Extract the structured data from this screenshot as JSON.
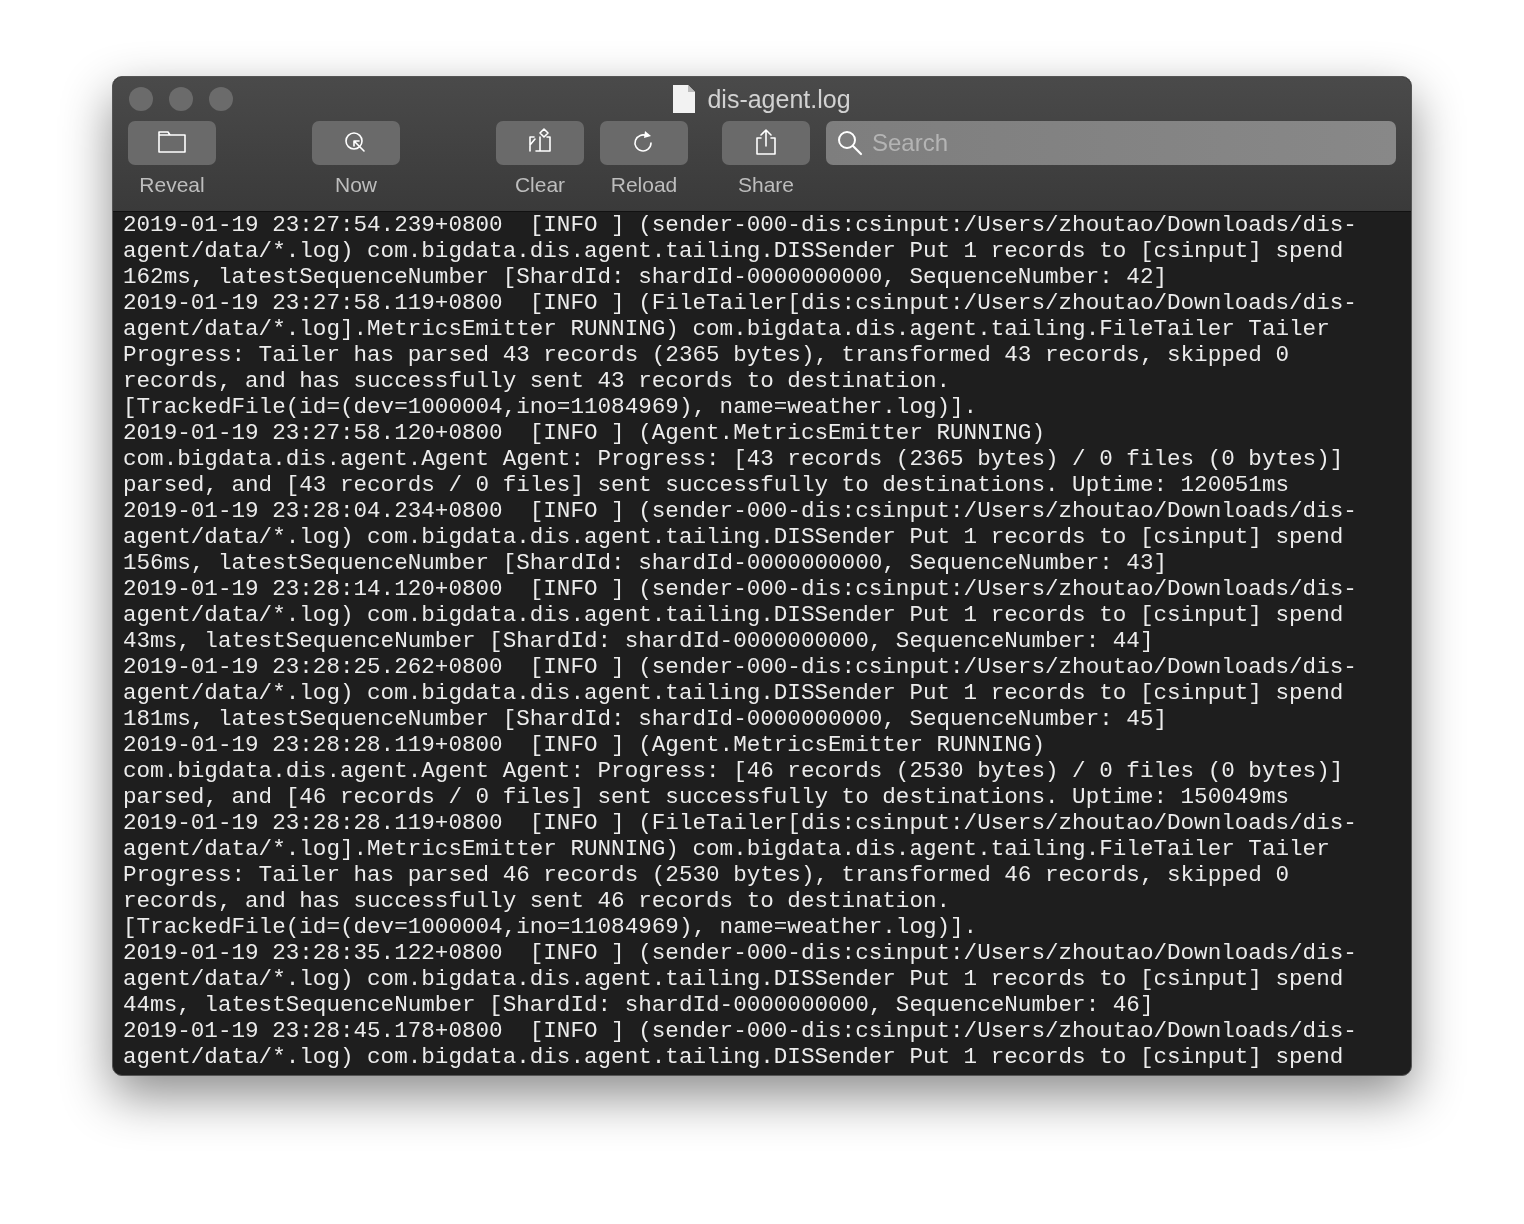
{
  "window": {
    "title": "dis-agent.log"
  },
  "toolbar": {
    "items": [
      {
        "label": "Reveal"
      },
      {
        "label": "Now"
      },
      {
        "label": "Clear"
      },
      {
        "label": "Reload"
      },
      {
        "label": "Share"
      }
    ]
  },
  "search": {
    "placeholder": "Search"
  },
  "log": {
    "lines": [
      "2019-01-19 23:27:54.239+0800  [INFO ] (sender-000-dis:csinput:/Users/zhoutao/Downloads/dis-",
      "agent/data/*.log) com.bigdata.dis.agent.tailing.DISSender Put 1 records to [csinput] spend",
      "162ms, latestSequenceNumber [ShardId: shardId-0000000000, SequenceNumber: 42]",
      "2019-01-19 23:27:58.119+0800  [INFO ] (FileTailer[dis:csinput:/Users/zhoutao/Downloads/dis-",
      "agent/data/*.log].MetricsEmitter RUNNING) com.bigdata.dis.agent.tailing.FileTailer Tailer",
      "Progress: Tailer has parsed 43 records (2365 bytes), transformed 43 records, skipped 0",
      "records, and has successfully sent 43 records to destination.",
      "[TrackedFile(id=(dev=1000004,ino=11084969), name=weather.log)].",
      "2019-01-19 23:27:58.120+0800  [INFO ] (Agent.MetricsEmitter RUNNING)",
      "com.bigdata.dis.agent.Agent Agent: Progress: [43 records (2365 bytes) / 0 files (0 bytes)]",
      "parsed, and [43 records / 0 files] sent successfully to destinations. Uptime: 120051ms",
      "2019-01-19 23:28:04.234+0800  [INFO ] (sender-000-dis:csinput:/Users/zhoutao/Downloads/dis-",
      "agent/data/*.log) com.bigdata.dis.agent.tailing.DISSender Put 1 records to [csinput] spend",
      "156ms, latestSequenceNumber [ShardId: shardId-0000000000, SequenceNumber: 43]",
      "2019-01-19 23:28:14.120+0800  [INFO ] (sender-000-dis:csinput:/Users/zhoutao/Downloads/dis-",
      "agent/data/*.log) com.bigdata.dis.agent.tailing.DISSender Put 1 records to [csinput] spend",
      "43ms, latestSequenceNumber [ShardId: shardId-0000000000, SequenceNumber: 44]",
      "2019-01-19 23:28:25.262+0800  [INFO ] (sender-000-dis:csinput:/Users/zhoutao/Downloads/dis-",
      "agent/data/*.log) com.bigdata.dis.agent.tailing.DISSender Put 1 records to [csinput] spend",
      "181ms, latestSequenceNumber [ShardId: shardId-0000000000, SequenceNumber: 45]",
      "2019-01-19 23:28:28.119+0800  [INFO ] (Agent.MetricsEmitter RUNNING)",
      "com.bigdata.dis.agent.Agent Agent: Progress: [46 records (2530 bytes) / 0 files (0 bytes)]",
      "parsed, and [46 records / 0 files] sent successfully to destinations. Uptime: 150049ms",
      "2019-01-19 23:28:28.119+0800  [INFO ] (FileTailer[dis:csinput:/Users/zhoutao/Downloads/dis-",
      "agent/data/*.log].MetricsEmitter RUNNING) com.bigdata.dis.agent.tailing.FileTailer Tailer",
      "Progress: Tailer has parsed 46 records (2530 bytes), transformed 46 records, skipped 0",
      "records, and has successfully sent 46 records to destination.",
      "[TrackedFile(id=(dev=1000004,ino=11084969), name=weather.log)].",
      "2019-01-19 23:28:35.122+0800  [INFO ] (sender-000-dis:csinput:/Users/zhoutao/Downloads/dis-",
      "agent/data/*.log) com.bigdata.dis.agent.tailing.DISSender Put 1 records to [csinput] spend",
      "44ms, latestSequenceNumber [ShardId: shardId-0000000000, SequenceNumber: 46]",
      "2019-01-19 23:28:45.178+0800  [INFO ] (sender-000-dis:csinput:/Users/zhoutao/Downloads/dis-",
      "agent/data/*.log) com.bigdata.dis.agent.tailing.DISSender Put 1 records to [csinput] spend"
    ]
  }
}
